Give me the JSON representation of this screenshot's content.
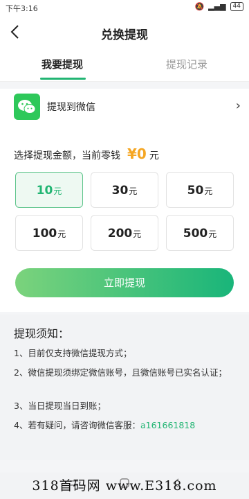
{
  "status": {
    "time": "下午3:16",
    "battery": "44"
  },
  "nav": {
    "title": "兑换提现"
  },
  "tabs": {
    "withdraw": "我要提现",
    "records": "提现记录"
  },
  "wechat": {
    "label": "提现到微信"
  },
  "amount": {
    "prefix": "选择提现金额，当前零钱",
    "currency": "¥",
    "value": "0",
    "unit": "元"
  },
  "options": [
    {
      "value": "10",
      "unit": "元"
    },
    {
      "value": "30",
      "unit": "元"
    },
    {
      "value": "50",
      "unit": "元"
    },
    {
      "value": "100",
      "unit": "元"
    },
    {
      "value": "200",
      "unit": "元"
    },
    {
      "value": "500",
      "unit": "元"
    }
  ],
  "submit": {
    "label": "立即提现"
  },
  "notice": {
    "title": "提现须知：",
    "items": [
      "1、目前仅支持微信提现方式；",
      "2、微信提现须绑定微信账号，且微信账号已实名认证；",
      "3、当日提现当日到账；",
      "4、若有疑问，请咨询微信客服："
    ],
    "contact": "a161661818"
  },
  "watermark": "318首码网 www.E318.com"
}
